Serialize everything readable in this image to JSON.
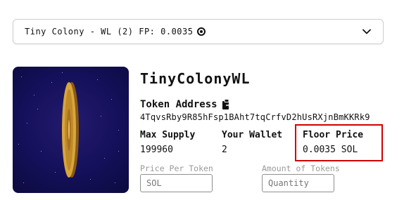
{
  "selector": {
    "label": "Tiny Colony - WL (2) FP: 0.0035",
    "coin_icon": "coin-icon",
    "chevron_icon": "chevron-down-icon"
  },
  "collection": {
    "title": "TinyColonyWL",
    "token_address_label": "Token Address",
    "token_address": "4TqvsRby9R85hFsp1BAht7tqCrfvD2hUsRXjnBmKKRk9",
    "copy_icon": "copy-icon"
  },
  "stats": {
    "max_supply_label": "Max Supply",
    "max_supply_value": "199960",
    "your_wallet_label": "Your Wallet",
    "your_wallet_value": "2",
    "floor_price_label": "Floor Price",
    "floor_price_value": "0.0035 SOL"
  },
  "form": {
    "price_label": "Price Per Token",
    "price_placeholder": "SOL",
    "amount_label": "Amount of Tokens",
    "amount_placeholder": "Quantity"
  },
  "colors": {
    "highlight": "#d10000",
    "art_background": "#14105a",
    "coin_gold": "#d4a034"
  }
}
